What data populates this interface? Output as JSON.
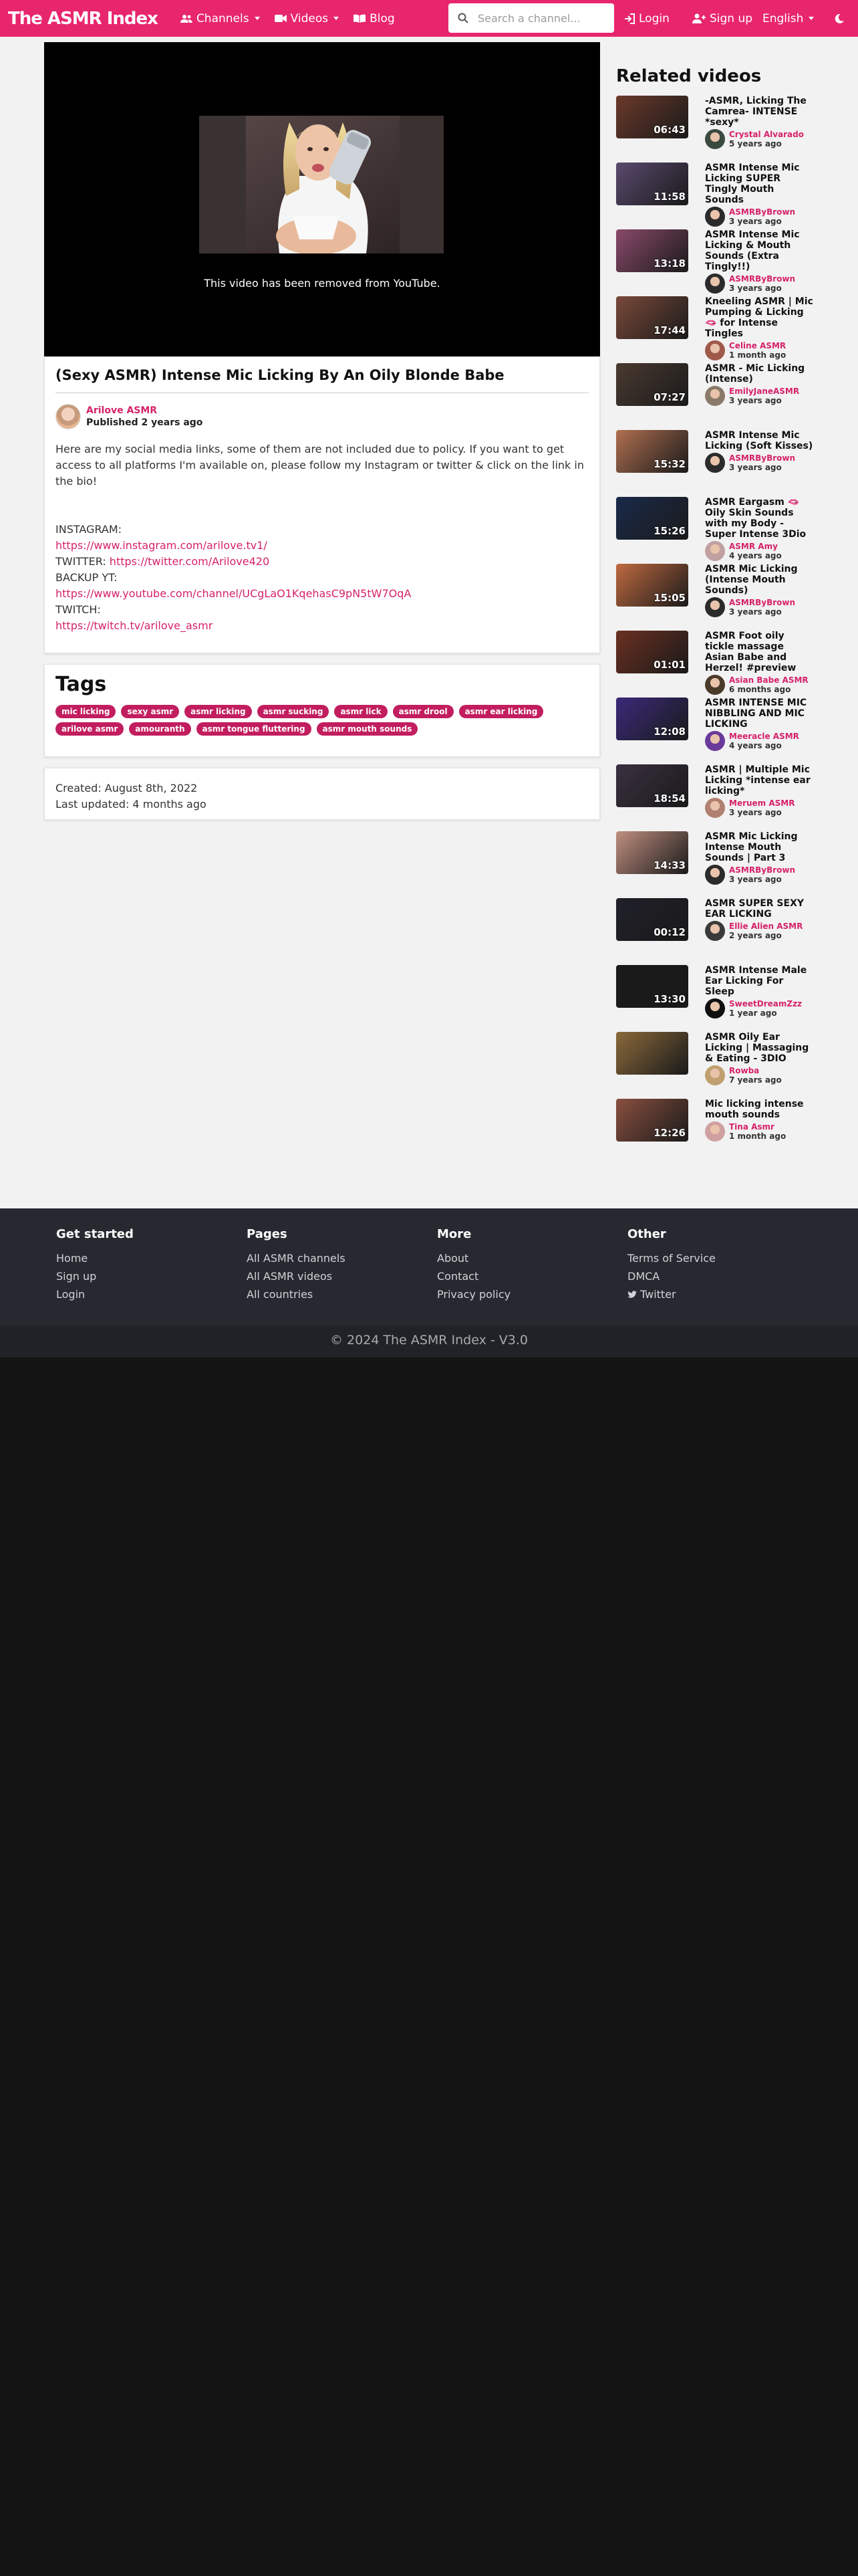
{
  "nav": {
    "brand": "The ASMR Index",
    "channels_label": "Channels",
    "videos_label": "Videos",
    "blog_label": "Blog",
    "search_placeholder": "Search a channel...",
    "login_label": "Login",
    "signup_label": "Sign up",
    "language_label": "English"
  },
  "video": {
    "removed_notice": "This video has been removed from YouTube.",
    "title": "(Sexy ASMR) Intense Mic Licking By An Oily Blonde Babe",
    "author": "Arilove ASMR",
    "published": "Published 2 years ago",
    "description_intro": "Here are my social media links, some of them are not included due to policy. If you want to get access to all platforms I'm available on, please follow my Instagram or twitter & click on the link in the bio!",
    "instagram_label": "INSTAGRAM:",
    "instagram_url": "https://www.instagram.com/arilove.tv1/",
    "twitter_label": "TWITTER:",
    "twitter_url": "https://twitter.com/Arilove420",
    "backup_label": "BACKUP YT:",
    "backup_url": "https://www.youtube.com/channel/UCgLaO1KqehasC9pN5tW7OqA",
    "twitch_label": "TWITCH:",
    "twitch_url": "https://twitch.tv/arilove_asmr"
  },
  "tags": {
    "title": "Tags",
    "items": [
      "mic licking",
      "sexy asmr",
      "asmr licking",
      "asmr sucking",
      "asmr lick",
      "asmr drool",
      "asmr ear licking",
      "arilove asmr",
      "amouranth",
      "asmr tongue fluttering",
      "asmr mouth sounds"
    ]
  },
  "dates": {
    "created": "Created: August 8th, 2022",
    "updated": "Last updated: 4 months ago"
  },
  "related": {
    "title": "Related videos",
    "items": [
      {
        "title": "-ASMR, Licking The Camrea- INTENSE *sexy*",
        "channel": "Crystal Alvarado",
        "age": "5 years ago",
        "duration": "06:43",
        "color": "#6b3a2a",
        "avatar": "#3b4a3f"
      },
      {
        "title": "ASMR Intense Mic Licking SUPER Tingly Mouth Sounds",
        "channel": "ASMRByBrown",
        "age": "3 years ago",
        "duration": "11:58",
        "color": "#5a4a6e",
        "avatar": "#2b2b2b"
      },
      {
        "title": "ASMR Intense Mic Licking & Mouth Sounds (Extra Tingly!!)",
        "channel": "ASMRByBrown",
        "age": "3 years ago",
        "duration": "13:18",
        "color": "#8a4a6a",
        "avatar": "#2b2b2b"
      },
      {
        "title": "Kneeling ASMR | Mic Pumping & Licking 🫦 for Intense Tingles",
        "channel": "Celine ASMR",
        "age": "1 month ago",
        "duration": "17:44",
        "color": "#7a4a3a",
        "avatar": "#a05a4a"
      },
      {
        "title": "ASMR - Mic Licking (Intense)",
        "channel": "EmilyJaneASMR",
        "age": "3 years ago",
        "duration": "07:27",
        "color": "#4a3a30",
        "avatar": "#8a7a6a"
      },
      {
        "title": "ASMR Intense Mic Licking (Soft Kisses)",
        "channel": "ASMRByBrown",
        "age": "3 years ago",
        "duration": "15:32",
        "color": "#b07050",
        "avatar": "#2b2b2b"
      },
      {
        "title": "ASMR Eargasm 🫦 Oily Skin Sounds with my Body - Super Intense 3Dio",
        "channel": "ASMR Amy",
        "age": "4 years ago",
        "duration": "15:26",
        "color": "#1a2a4a",
        "avatar": "#c0a0a0"
      },
      {
        "title": "ASMR Mic Licking (Intense Mouth Sounds)",
        "channel": "ASMRByBrown",
        "age": "3 years ago",
        "duration": "15:05",
        "color": "#c06a40",
        "avatar": "#2b2b2b"
      },
      {
        "title": "ASMR Foot oily tickle massage Asian Babe and Herzel! #preview",
        "channel": "Asian Babe ASMR",
        "age": "6 months ago",
        "duration": "01:01",
        "color": "#6a3020",
        "avatar": "#4a3a2a"
      },
      {
        "title": "ASMR INTENSE MIC NIBBLING AND MIC LICKING",
        "channel": "Meeracle ASMR",
        "age": "4 years ago",
        "duration": "12:08",
        "color": "#3a2a7a",
        "avatar": "#6a3a9a"
      },
      {
        "title": "ASMR | Multiple Mic Licking *intense ear licking*",
        "channel": "Meruem ASMR",
        "age": "3 years ago",
        "duration": "18:54",
        "color": "#3a3040",
        "avatar": "#b08070"
      },
      {
        "title": "ASMR Mic Licking Intense Mouth Sounds | Part 3",
        "channel": "ASMRByBrown",
        "age": "3 years ago",
        "duration": "14:33",
        "color": "#c09080",
        "avatar": "#2b2b2b"
      },
      {
        "title": "ASMR SUPER SEXY EAR LICKING",
        "channel": "Ellie Alien ASMR",
        "age": "2 years ago",
        "duration": "00:12",
        "color": "#20202a",
        "avatar": "#3a3a3a"
      },
      {
        "title": "ASMR Intense Male Ear Licking For Sleep",
        "channel": "SweetDreamZzz",
        "age": "1 year ago",
        "duration": "13:30",
        "color": "#1a1a1a",
        "avatar": "#101010"
      },
      {
        "title": "ASMR Oily Ear Licking | Massaging & Eating - 3DIO",
        "channel": "Rowba",
        "age": "7 years ago",
        "duration": "",
        "color": "#8a6a3a",
        "avatar": "#c0a070"
      },
      {
        "title": "Mic licking intense mouth sounds",
        "channel": "Tina Asmr",
        "age": "1 month ago",
        "duration": "12:26",
        "color": "#8a5040",
        "avatar": "#d0a0a0"
      }
    ]
  },
  "footer": {
    "col1": {
      "title": "Get started",
      "links": [
        "Home",
        "Sign up",
        "Login"
      ]
    },
    "col2": {
      "title": "Pages",
      "links": [
        "All ASMR channels",
        "All ASMR videos",
        "All countries"
      ]
    },
    "col3": {
      "title": "More",
      "links": [
        "About",
        "Contact",
        "Privacy policy"
      ]
    },
    "col4": {
      "title": "Other",
      "links": [
        "Terms of Service",
        "DMCA",
        "Twitter"
      ]
    },
    "copyright": "© 2024 The ASMR Index - V3.0"
  },
  "colors": {
    "accent": "#e8266d",
    "tag": "#c21e5f",
    "link": "#d6226a",
    "footer": "#262a30"
  }
}
